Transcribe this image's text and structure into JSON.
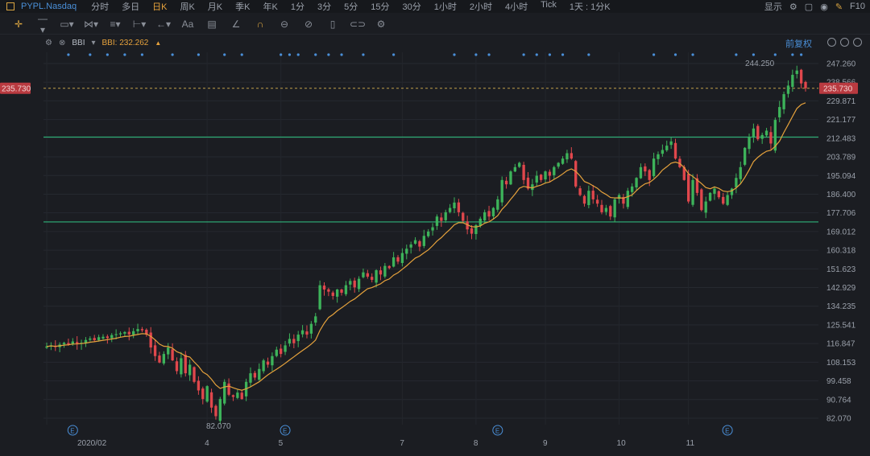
{
  "topbar": {
    "symbol": "PYPL.Nasdaq",
    "timeframes": [
      "分时",
      "多日",
      "日K",
      "周K",
      "月K",
      "季K",
      "年K",
      "1分",
      "3分",
      "5分",
      "15分",
      "30分",
      "1小时",
      "2小时",
      "4小时",
      "Tick",
      "1天 : 1分K"
    ],
    "active_index": 2,
    "display_label": "显示",
    "f10_label": "F10"
  },
  "indicator": {
    "name": "BBI",
    "value_text": "BBI: 232.262",
    "adjust_label": "前复权"
  },
  "colors": {
    "background": "#1b1d22",
    "up": "#3db35a",
    "down": "#e0474c",
    "bbi": "#e6a23c",
    "support": "#2fb37a",
    "price_line": "#c2a04a",
    "price_tag": "#b93a40",
    "event_dot": "#4a8fd8"
  },
  "chart_data": {
    "type": "candlestick",
    "title": "",
    "y_ticks": [
      247.26,
      238.566,
      229.871,
      221.177,
      212.483,
      203.789,
      195.094,
      186.4,
      177.706,
      169.012,
      160.318,
      151.623,
      142.929,
      134.235,
      125.541,
      116.847,
      108.153,
      99.458,
      90.764,
      82.07
    ],
    "ylim": [
      82.07,
      247.26
    ],
    "current_price": 235.73,
    "current_price_label": "235.730",
    "high_annotation": {
      "value": 244.25,
      "label": "244.250"
    },
    "low_annotation": {
      "value": 82.07,
      "label": "82.070"
    },
    "support_lines": [
      213.0,
      173.5
    ],
    "x_labels": [
      {
        "label": "2020/02",
        "index": 0
      },
      {
        "label": "4",
        "index": 37
      },
      {
        "label": "5",
        "index": 54
      },
      {
        "label": "7",
        "index": 82
      },
      {
        "label": "8",
        "index": 99
      },
      {
        "label": "9",
        "index": 115
      },
      {
        "label": "10",
        "index": 132
      },
      {
        "label": "11",
        "index": 148
      }
    ],
    "earnings_markers": [
      6,
      55,
      104,
      157
    ],
    "earnings_label": "E",
    "event_dots": [
      5,
      10,
      14,
      18,
      22,
      29,
      35,
      41,
      45,
      54,
      56,
      58,
      62,
      65,
      68,
      73,
      80,
      94,
      99,
      102,
      110,
      113,
      116,
      119,
      125,
      140,
      145,
      149,
      159,
      163,
      168,
      172,
      174
    ],
    "series": [
      {
        "type": "ohlc",
        "close": [
          115.5,
          116.0,
          115.2,
          116.4,
          117.2,
          116.5,
          117.8,
          116.8,
          117.2,
          118.5,
          119.2,
          118.4,
          119.8,
          120.0,
          119.4,
          120.8,
          121.2,
          121.6,
          122.2,
          121.1,
          122.6,
          123.6,
          123.0,
          121.0,
          115.0,
          111.0,
          108.0,
          112.0,
          115.0,
          109.0,
          104.0,
          110.0,
          103.0,
          107.0,
          99.0,
          95.0,
          91.0,
          97.0,
          87.0,
          83.0,
          91.0,
          99.0,
          93.0,
          92.0,
          94.0,
          91.0,
          99.0,
          103.0,
          101.0,
          105.0,
          109.0,
          107.0,
          111.0,
          114.0,
          112.0,
          116.0,
          119.0,
          117.0,
          121.0,
          123.0,
          121.0,
          126.0,
          129.5,
          144.0,
          142.0,
          141.0,
          139.0,
          142.0,
          140.5,
          144.0,
          146.0,
          143.0,
          147.0,
          150.0,
          148.0,
          146.5,
          151.0,
          149.0,
          153.0,
          152.0,
          157.0,
          155.0,
          159.0,
          161.0,
          163.0,
          165.0,
          162.0,
          167.0,
          169.0,
          171.0,
          176.0,
          174.0,
          178.0,
          180.0,
          182.5,
          178.0,
          174.0,
          170.0,
          168.0,
          172.0,
          175.0,
          178.0,
          176.0,
          180.0,
          184.0,
          193.0,
          191.0,
          197.0,
          199.0,
          201.0,
          193.0,
          189.0,
          191.0,
          195.0,
          193.0,
          197.0,
          195.0,
          199.0,
          201.0,
          203.0,
          205.5,
          203.0,
          190.0,
          186.0,
          182.0,
          188.0,
          184.0,
          182.0,
          178.0,
          180.0,
          176.0,
          184.0,
          186.0,
          182.0,
          188.0,
          190.0,
          194.0,
          199.0,
          197.0,
          193.0,
          203.0,
          205.0,
          207.0,
          209.0,
          211.0,
          203.0,
          199.0,
          193.0,
          183.0,
          193.0,
          187.0,
          179.0,
          183.0,
          187.0,
          189.0,
          185.0,
          182.0,
          186.0,
          189.0,
          194.0,
          199.0,
          208.0,
          213.0,
          217.0,
          212.0,
          214.0,
          216.0,
          210.0,
          221.0,
          227.0,
          233.0,
          237.0,
          242.0,
          244.0,
          238.0,
          235.73
        ]
      },
      {
        "name": "BBI",
        "type": "line",
        "values": "computed: mean of 3/6/12/24-bar moving averages of close"
      }
    ]
  }
}
